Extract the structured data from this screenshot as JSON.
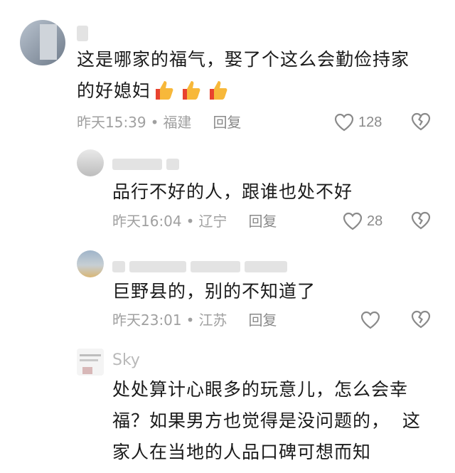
{
  "comments": [
    {
      "text": "这是哪家的福气，娶了个这么会勤俭持家\n的好媳妇",
      "emoji": [
        "thumbs-up",
        "thumbs-up",
        "thumbs-up"
      ],
      "time": "昨天15:39",
      "location": "福建",
      "reply": "回复",
      "likes": "128"
    },
    {
      "text": "品行不好的人，跟谁也处不好",
      "time": "昨天16:04",
      "location": "辽宁",
      "reply": "回复",
      "likes": "28"
    },
    {
      "text": "巨野县的，别的不知道了",
      "time": "昨天23:01",
      "location": "江苏",
      "reply": "回复",
      "likes": ""
    },
    {
      "username": "Sky",
      "text": "处处算计心眼多的玩意儿，怎么会幸\n福？如果男方也觉得是没问题的，  这\n家人在当地的人品口碑可想而知"
    }
  ],
  "colors": {
    "text": "#1a1a1a",
    "meta": "#a0a0a0",
    "icon": "#8a8a8a",
    "thumb": "#f7b83a"
  }
}
